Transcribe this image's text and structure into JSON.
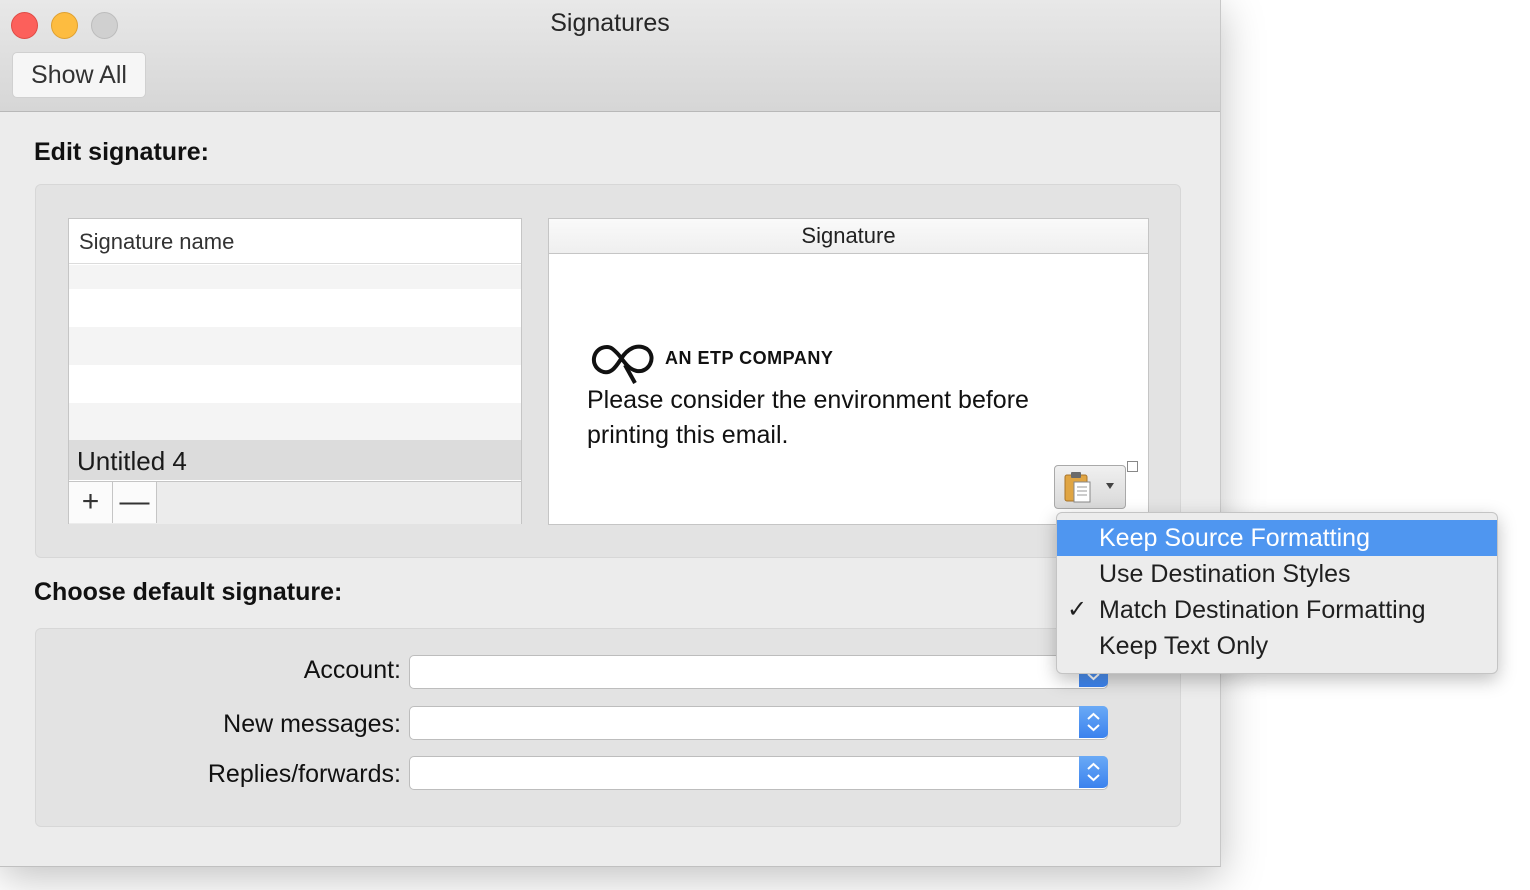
{
  "window": {
    "title": "Signatures",
    "toolbar": {
      "show_all_label": "Show All"
    }
  },
  "edit_section": {
    "title": "Edit signature:",
    "name_list": {
      "header": "Signature name",
      "items": [
        "Untitled 4"
      ],
      "add_label": "+",
      "remove_label": "—"
    },
    "signature_panel": {
      "header": "Signature",
      "logo_text": "AN ETP COMPANY",
      "body_text_line1": "Please consider the environment before",
      "body_text_line2": "printing this email."
    }
  },
  "paste_menu": {
    "items": [
      {
        "label": "Keep Source Formatting",
        "highlighted": true,
        "checked": false
      },
      {
        "label": "Use Destination Styles",
        "highlighted": false,
        "checked": false
      },
      {
        "label": "Match Destination Formatting",
        "highlighted": false,
        "checked": true
      },
      {
        "label": "Keep Text Only",
        "highlighted": false,
        "checked": false
      }
    ],
    "check_glyph": "✓"
  },
  "default_section": {
    "title": "Choose default signature:",
    "fields": [
      {
        "label": "Account:",
        "value": ""
      },
      {
        "label": "New messages:",
        "value": ""
      },
      {
        "label": "Replies/forwards:",
        "value": ""
      }
    ]
  },
  "colors": {
    "accent": "#4f96f0",
    "close": "#fc605b",
    "minimize": "#fdbc40",
    "zoom_disabled": "#d0d0d0"
  }
}
